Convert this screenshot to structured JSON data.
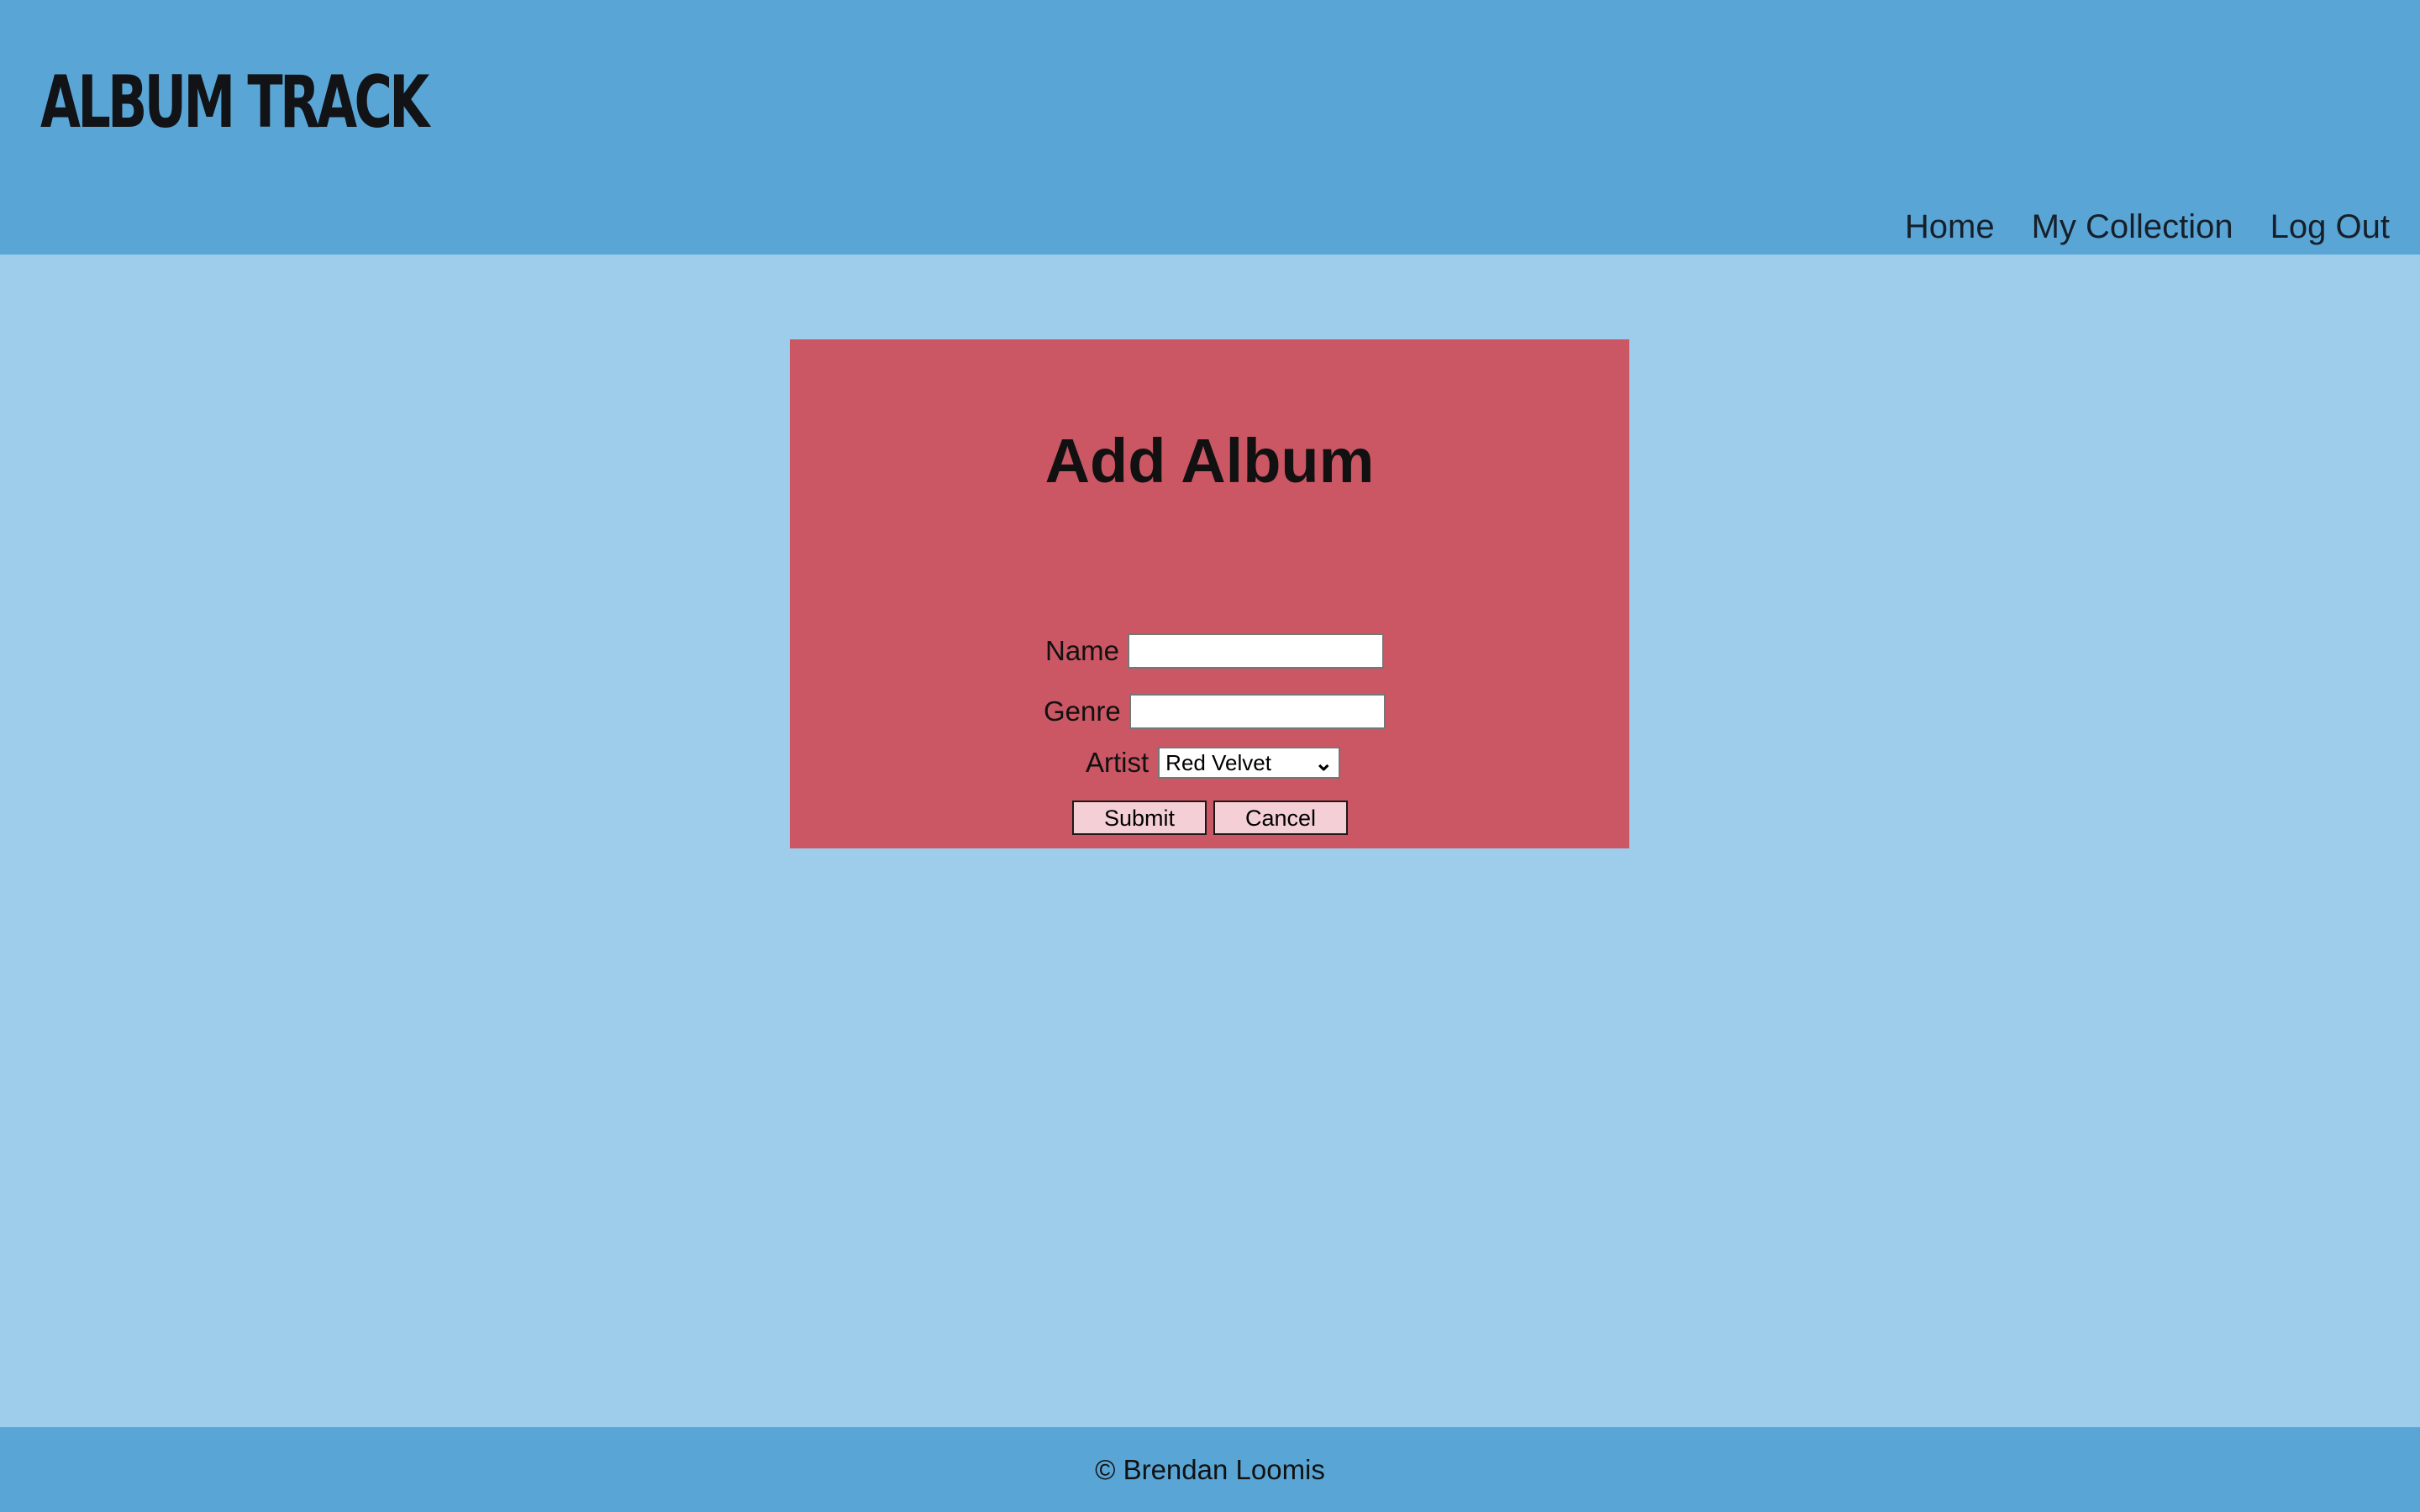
{
  "header": {
    "brand": "ALBUM TRACK",
    "nav": [
      "Home",
      "My Collection",
      "Log Out"
    ],
    "background_color": "#59a6d6"
  },
  "main": {
    "background_color": "#9dcdeb",
    "card": {
      "background_color": "#cb5764",
      "title": "Add Album",
      "fields": {
        "name": {
          "label": "Name",
          "value": ""
        },
        "genre": {
          "label": "Genre",
          "value": ""
        },
        "artist": {
          "label": "Artist",
          "selected": "Red Velvet"
        }
      },
      "buttons": {
        "submit": "Submit",
        "cancel": "Cancel"
      }
    }
  },
  "footer": {
    "text": "© Brendan Loomis"
  }
}
